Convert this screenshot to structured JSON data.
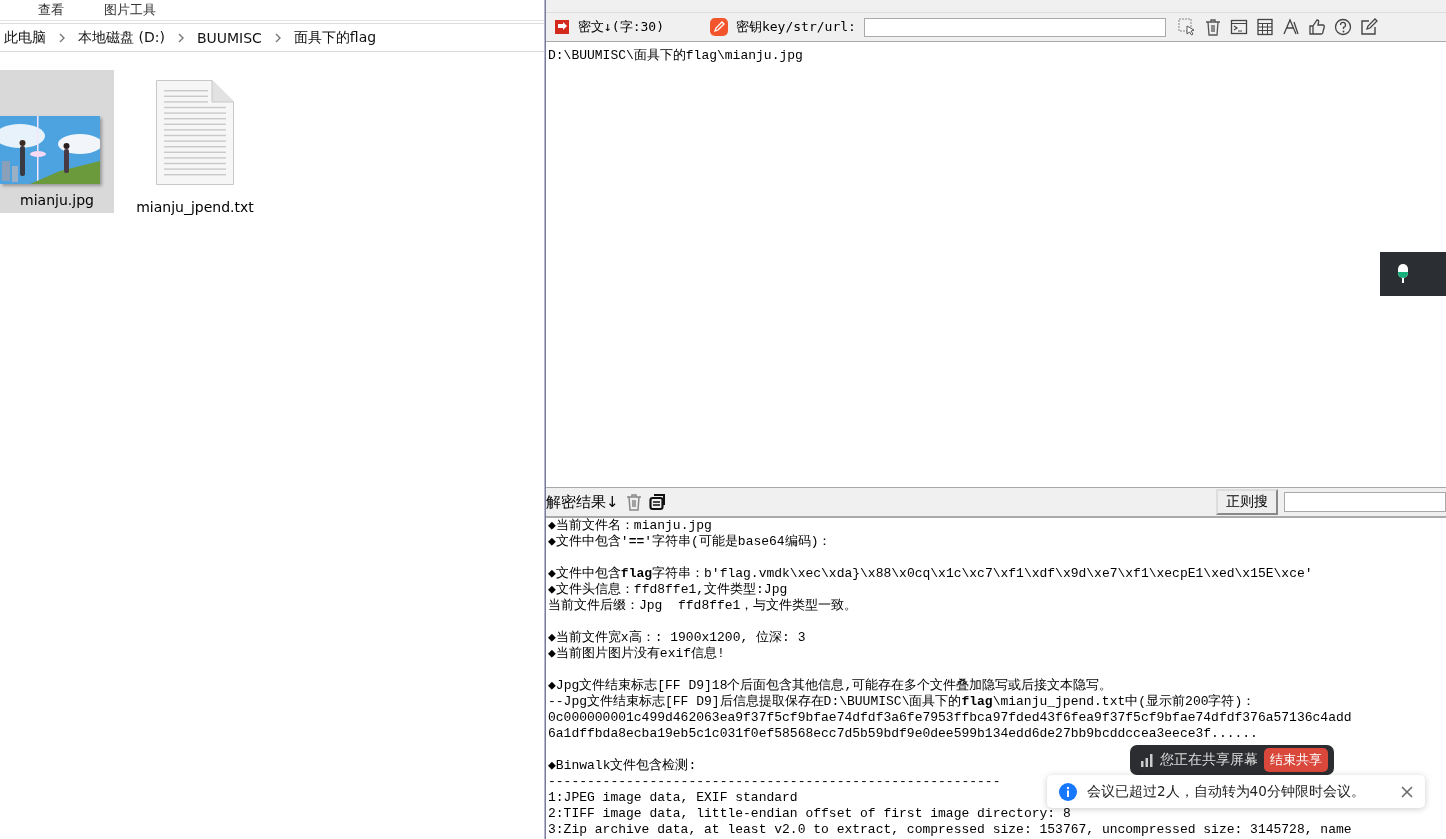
{
  "explorer": {
    "tabs": [
      "查看",
      "图片工具"
    ],
    "breadcrumb": [
      "此电脑",
      "本地磁盘 (D:)",
      "BUUMISC",
      "面具下的flag"
    ],
    "files": [
      {
        "name": "mianju.jpg",
        "selected": true
      },
      {
        "name": "mianju_jpend.txt",
        "kind": "text",
        "selected": false
      }
    ]
  },
  "tool": {
    "cipher_label": "密文↓(字:30)",
    "key_label": "密钥key/str/url:",
    "input_text": "D:\\BUUMISC\\面具下的flag\\mianju.jpg",
    "result_label": "解密结果↓",
    "regex_button": "正则搜",
    "result_blocks": [
      [
        "◆当前文件名：mianju.jpg",
        "◆文件中包含'**==**'字符串(可能是base64编码)："
      ],
      [
        "◆文件中包含**flag**字符串：b'flag.vmdk\\xec\\xda}\\x88\\x0cq\\x1c\\xc7\\xf1\\xdf\\x9d\\xe7\\xf1\\xecpE1\\xed\\x15E\\xce'",
        "◆文件头信息：ffd8ffe1,文件类型:Jpg",
        "当前文件后缀：Jpg  ffd8ffe1，与文件类型一致。"
      ],
      [
        "◆当前文件宽x高：: 1900x1200, 位深: 3",
        "◆当前图片图片没有exif信息!"
      ],
      [
        "◆Jpg文件结束标志[FF D9]18个后面包含其他信息,可能存在多个文件叠加隐写或后接文本隐写。",
        "--Jpg文件结束标志[FF D9]后信息提取保存在D:\\BUUMISC\\面具下的**flag**\\mianju_jpend.txt中(显示前200字符)：",
        "0c000000001c499d462063ea9f37f5cf9bfae74dfdf3a6fe7953ffbca97fded43f6fea9f37f5cf9bfae74dfdf376a57136c4add",
        "6a1dffbda8ecba19eb5c1c031f0ef58568ecc7d5b59bdf9e0dee599b134edd6de27bb9bcddccea3eece3f......"
      ],
      [
        "◆Binwalk文件包含检测:",
        "----------------------------------------------------------",
        "1:JPEG image data, EXIF standard",
        "2:TIFF image data, little-endian offset of first image directory: 8",
        "3:Zip archive data, at least v2.0 to extract, compressed size: 153767, uncompressed size: 3145728, name"
      ]
    ]
  },
  "share_bar": {
    "text": "您正在共享屏幕",
    "button": "结束共享"
  },
  "notification": {
    "text": "会议已超过2人，自动转为40分钟限时会议。"
  }
}
